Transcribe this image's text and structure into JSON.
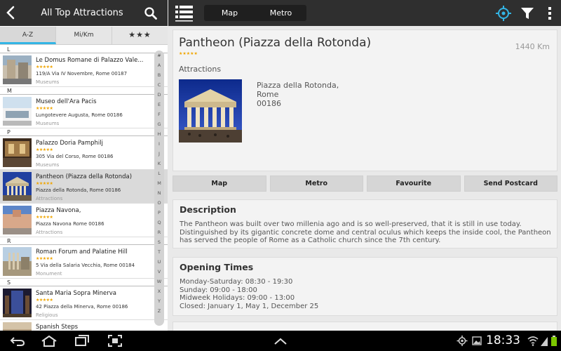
{
  "left_header": {
    "title": "All Top Attractions",
    "back_icon": "back-arrow-icon",
    "search_icon": "search-icon"
  },
  "sort_tabs": [
    "A-Z",
    "Mi/Km",
    "★★★"
  ],
  "sections": {
    "L": {
      "letter": "L",
      "items": [
        {
          "name": "Le Domus Romane di Palazzo Vale...",
          "stars": "★★★★★",
          "address": "119/A Via IV Novembre,  Rome  00187",
          "category": "Museums"
        }
      ]
    },
    "M": {
      "letter": "M",
      "items": [
        {
          "name": "Museo dell'Ara Pacis",
          "stars": "★★★★★",
          "address": "Lungotevere Augusta,  Rome  00186",
          "category": "Museums"
        }
      ]
    },
    "P": {
      "letter": "P",
      "items": [
        {
          "name": "Palazzo Doria Pamphilj",
          "stars": "★★★★★",
          "address": "305 Via del Corso,  Rome  00186",
          "category": "Museums"
        },
        {
          "name": "Pantheon (Piazza della Rotonda)",
          "stars": "★★★★★",
          "address": "Piazza della Rotonda,  Rome  00186",
          "category": "Attractions"
        },
        {
          "name": "Piazza Navona,",
          "stars": "★★★★★",
          "address": "Piazza Navona  Rome  00186",
          "category": "Attractions"
        }
      ]
    },
    "R": {
      "letter": "R",
      "items": [
        {
          "name": "Roman Forum and Palatine Hill",
          "stars": "★★★★★",
          "address": "5 Via della Salaria Vecchia,  Rome  00184",
          "category": "Monument"
        }
      ]
    },
    "S": {
      "letter": "S",
      "items": [
        {
          "name": "Santa Maria Sopra Minerva",
          "stars": "★★★★★",
          "address": "42 Piazza della Minerva,  Rome  00186",
          "category": "Religious"
        },
        {
          "name": "Spanish Steps",
          "stars": "",
          "address": "",
          "category": ""
        }
      ]
    }
  },
  "alphabet": [
    "#",
    "A",
    "B",
    "C",
    "D",
    "E",
    "F",
    "G",
    "H",
    "I",
    "J",
    "K",
    "L",
    "M",
    "N",
    "O",
    "P",
    "Q",
    "R",
    "S",
    "T",
    "U",
    "V",
    "W",
    "X",
    "Y",
    "Z"
  ],
  "right_header": {
    "seg_map": "Map",
    "seg_metro": "Metro",
    "menu_icon": "list-menu-icon",
    "locate_icon": "locate-target-icon",
    "filter_icon": "filter-icon",
    "more_icon": "overflow-menu-icon",
    "accent": "#33b5e5"
  },
  "detail": {
    "title": "Pantheon (Piazza della Rotonda)",
    "stars": "★★★★★",
    "distance": "1440 Km",
    "category": "Attractions",
    "address_line1": "Piazza della Rotonda,",
    "address_line2": "Rome",
    "address_line3": "00186"
  },
  "actions": [
    "Map",
    "Metro",
    "Favourite",
    "Send Postcard"
  ],
  "description": {
    "title": "Description",
    "body": "The Pantheon was built over two millenia ago and is so well-preserved, that it is still in use today. Distinguished by its gigantic concrete dome and central oculus which keeps the inside cool, the Pantheon has served the people of Rome as a Catholic church since the 7th century."
  },
  "opening": {
    "title": "Opening Times",
    "lines": [
      "Monday-Saturday: 08:30 - 19:30",
      "Sunday: 09:00 - 18:00",
      "Midweek Holidays: 09:00 - 13:00",
      "Closed: January 1, May 1, December 25"
    ]
  },
  "system_bar": {
    "time": "18:33",
    "icons": [
      "back-icon",
      "home-icon",
      "recent-apps-icon",
      "screenshot-icon",
      "up-chevron-icon",
      "location-icon",
      "image-icon",
      "wifi-icon",
      "signal-icon",
      "battery-icon"
    ]
  }
}
